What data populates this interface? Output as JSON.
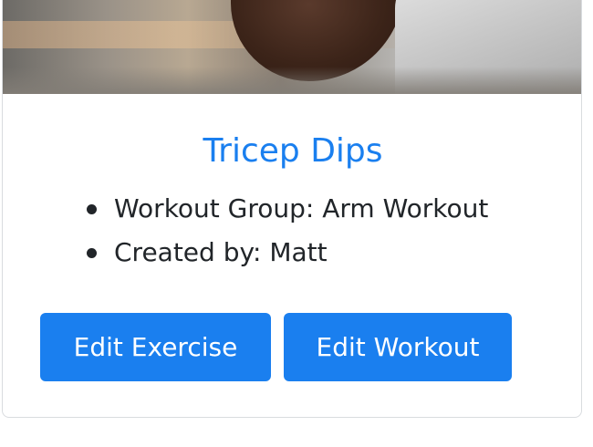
{
  "card": {
    "title": "Tricep Dips",
    "details": [
      "Workout Group: Arm Workout",
      "Created by: Matt"
    ],
    "buttons": {
      "edit_exercise": "Edit Exercise",
      "edit_workout": "Edit Workout"
    }
  },
  "colors": {
    "accent": "#1a7fef",
    "text": "#212529",
    "border": "#d9dcdf"
  }
}
